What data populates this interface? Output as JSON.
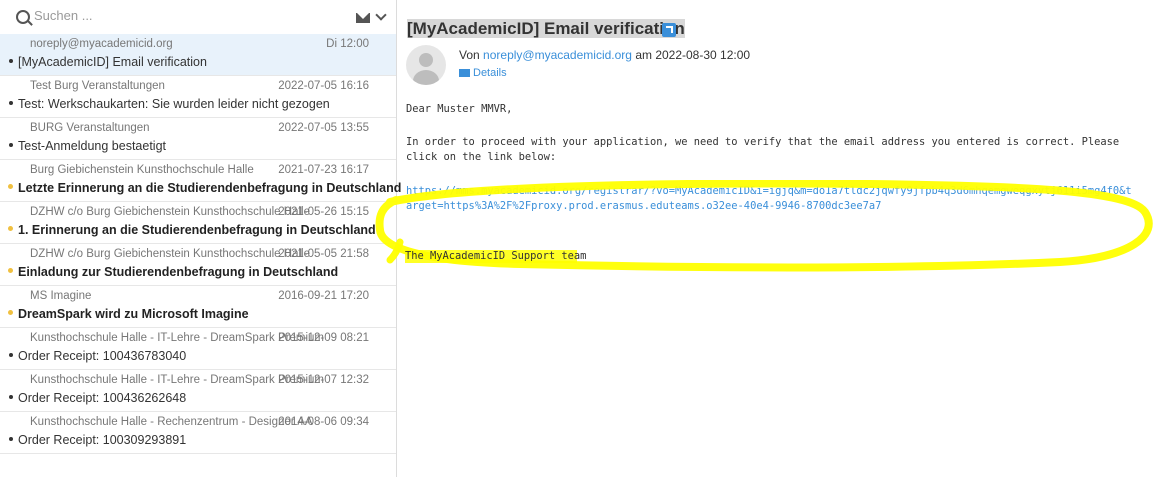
{
  "search": {
    "placeholder": "Suchen ..."
  },
  "icons": {
    "search": "search-icon",
    "mail": "envelope-icon",
    "menu": "chevron-down-icon",
    "open_external": "external-link-icon",
    "details": "envelope-icon"
  },
  "colors": {
    "accent": "#3a8fd9",
    "selected_bg": "#e8f2fb",
    "unread_dot": "#f0c040",
    "highlight_marker": "#ffff00"
  },
  "mail_list": [
    {
      "sender": "noreply@myacademicid.org",
      "date": "Di 12:00",
      "subject": "[MyAcademicID] Email verification",
      "unread": false,
      "selected": true
    },
    {
      "sender": "Test Burg Veranstaltungen",
      "date": "2022-07-05 16:16",
      "subject": "Test: Werkschaukarten: Sie wurden leider nicht gezogen",
      "unread": false,
      "selected": false
    },
    {
      "sender": "BURG Veranstaltungen",
      "date": "2022-07-05 13:55",
      "subject": "Test-Anmeldung bestaetigt",
      "unread": false,
      "selected": false
    },
    {
      "sender": "Burg Giebichenstein Kunsthochschule Halle",
      "date": "2021-07-23 16:17",
      "subject": "Letzte Erinnerung an die Studierendenbefragung in Deutschland",
      "unread": true,
      "selected": false
    },
    {
      "sender": "DZHW c/o Burg Giebichenstein Kunsthochschule Halle",
      "date": "2021-05-26 15:15",
      "subject": "1. Erinnerung an die Studierendenbefragung in Deutschland",
      "unread": true,
      "selected": false
    },
    {
      "sender": "DZHW c/o Burg Giebichenstein Kunsthochschule Halle",
      "date": "2021-05-05 21:58",
      "subject": "Einladung zur Studierendenbefragung in Deutschland",
      "unread": true,
      "selected": false
    },
    {
      "sender": "MS Imagine",
      "date": "2016-09-21 17:20",
      "subject": "DreamSpark wird zu Microsoft Imagine",
      "unread": true,
      "selected": false
    },
    {
      "sender": "Kunsthochschule Halle - IT-Lehre - DreamSpark Premium",
      "date": "2015-12-09 08:21",
      "subject": "Order Receipt: 100436783040",
      "unread": false,
      "selected": false
    },
    {
      "sender": "Kunsthochschule Halle - IT-Lehre - DreamSpark Premium",
      "date": "2015-12-07 12:32",
      "subject": "Order Receipt: 100436262648",
      "unread": false,
      "selected": false
    },
    {
      "sender": "Kunsthochschule Halle - Rechenzentrum - Designer AA",
      "date": "2014-08-06 09:34",
      "subject": "Order Receipt: 100309293891",
      "unread": false,
      "selected": false
    }
  ],
  "message": {
    "subject": "[MyAcademicID] Email verification",
    "from_prefix": "Von",
    "from_address": "noreply@myacademicid.org",
    "from_suffix": "am 2022-08-30 12:00",
    "details_label": "Details",
    "greeting": "Dear Muster MMVR,",
    "intro": "In order to proceed with your application, we need to verify that the email address you entered is correct. Please click on the link below:",
    "link": "https://mms.myacademicid.org/registrar/?vo=MyAcademicID&i=igjq&m=do1a7tldc2jqwfy9jfpb4q3d6mhqemgweqgxytj611i5mg4f0&target=https%3A%2F%2Fproxy.prod.erasmus.eduteams.o32ee-40e4-9946-8700dc3ee7a7",
    "signature": "The MyAcademicID Support team"
  }
}
